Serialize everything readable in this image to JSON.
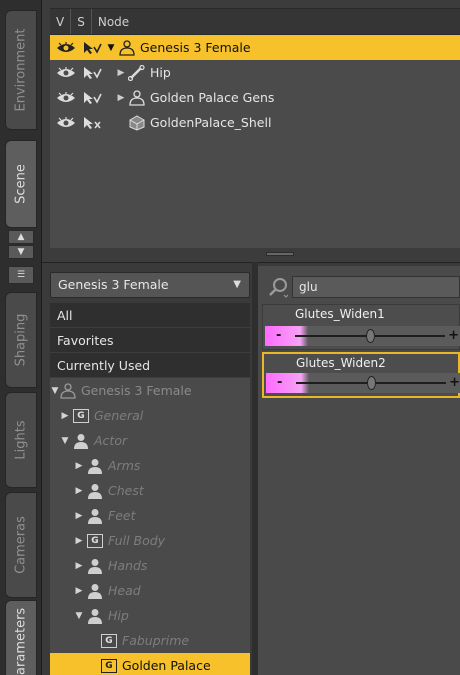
{
  "side_tabs": {
    "environment": "Environment",
    "scene": "Scene",
    "shaping": "Shaping",
    "lights": "Lights",
    "cameras": "Cameras",
    "parameters": "Parameters"
  },
  "scene": {
    "headers": {
      "v": "V",
      "s": "S",
      "node": "Node"
    },
    "rows": [
      {
        "label": "Genesis 3 Female",
        "selected": true,
        "icon": "figure-icon"
      },
      {
        "label": "Hip",
        "icon": "bone-icon"
      },
      {
        "label": "Golden Palace Gens",
        "icon": "figure-icon"
      },
      {
        "label": "GoldenPalace_Shell",
        "icon": "prop-icon"
      }
    ]
  },
  "params": {
    "figure_dropdown": "Genesis 3 Female",
    "categories": [
      "All",
      "Favorites",
      "Currently Used"
    ],
    "tree": {
      "root": "Genesis 3 Female",
      "general": "General",
      "actor": "Actor",
      "arms": "Arms",
      "chest": "Chest",
      "feet": "Feet",
      "full_body": "Full Body",
      "hands": "Hands",
      "head": "Head",
      "hip": "Hip",
      "fabuprime": "Fabuprime",
      "golden_palace": "Golden Palace"
    },
    "group_icon_letter": "G",
    "search_value": "glu",
    "sliders": [
      {
        "name": "Glutes_Widen1",
        "value_fraction": 0.5
      },
      {
        "name": "Glutes_Widen2",
        "value_fraction": 0.5
      }
    ],
    "minus": "-",
    "plus": "+"
  },
  "colors": {
    "selection": "#f6c12a",
    "slider_fill": "#ff6bff"
  }
}
